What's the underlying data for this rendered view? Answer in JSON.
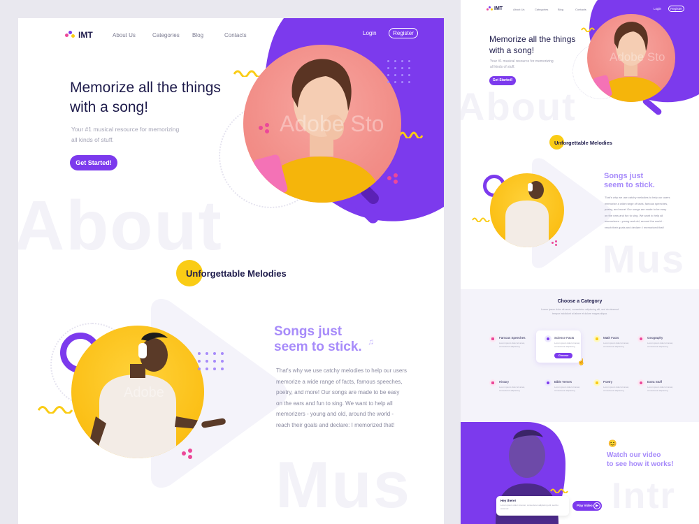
{
  "brand": {
    "name": "IMT"
  },
  "nav": {
    "links": [
      "About Us",
      "Categories",
      "Blog",
      "Contacts"
    ],
    "login": "Login",
    "register": "Register"
  },
  "hero": {
    "title_line1": "Memorize all the things",
    "title_line2": "with a song!",
    "subtitle_line1": "Your #1 musical resource for memorizing",
    "subtitle_line2": "all kinds of stuff.",
    "cta": "Get Started!",
    "watermark": "Adobe Sto"
  },
  "ghost_words": {
    "about": "About",
    "music": "Mus",
    "intro": "Intr"
  },
  "melodies": {
    "title": "Unforgettable Melodies"
  },
  "songs": {
    "title_line1": "Songs just",
    "title_line2": "seem to stick.",
    "body": [
      "That's why we use catchy melodies to help our users",
      "memorize a wide range of facts, famous speeches,",
      "poetry, and more! Our songs are made to be easy",
      "on the ears and fun to sing. We want to help all",
      "memorizers - young and old, around the world -",
      "reach their goals and declare: I memorized that!"
    ],
    "watermark": "Adobe"
  },
  "categories": {
    "title": "Choose a Category",
    "subtitle_line1": "Lorem ipsum dolor sit amet, consectetur adipiscing elit, sed do eiusmod",
    "subtitle_line2": "tempor incididunt ut labore et dolore magna aliqua.",
    "items": [
      {
        "label": "Famous Speeches",
        "color": "#ec4899"
      },
      {
        "label": "Science Facts",
        "color": "#7c3aed"
      },
      {
        "label": "Math Facts",
        "color": "#facc15"
      },
      {
        "label": "Geography",
        "color": "#ec4899"
      },
      {
        "label": "History",
        "color": "#ec4899"
      },
      {
        "label": "Bible Verses",
        "color": "#7c3aed"
      },
      {
        "label": "Poetry",
        "color": "#facc15"
      },
      {
        "label": "Extra Stuff",
        "color": "#ec4899"
      }
    ],
    "item_desc_line1": "Lorem ipsum dolor sit amet,",
    "item_desc_line2": "consectetur adipiscing",
    "choose_button": "Choose"
  },
  "video": {
    "title_line1": "Watch our video",
    "title_line2": "to see how it works!",
    "chat_title": "Hey there!",
    "chat_text": "Lorem ipsum dolor sit amet, consectetur adipiscing elit, sed do eiusmod",
    "play_button": "Play Video"
  },
  "colors": {
    "purple": "#7c3aed",
    "lavender": "#a78bfa",
    "yellow": "#facc15",
    "pink": "#ec4899",
    "navy": "#1e1b4b"
  }
}
